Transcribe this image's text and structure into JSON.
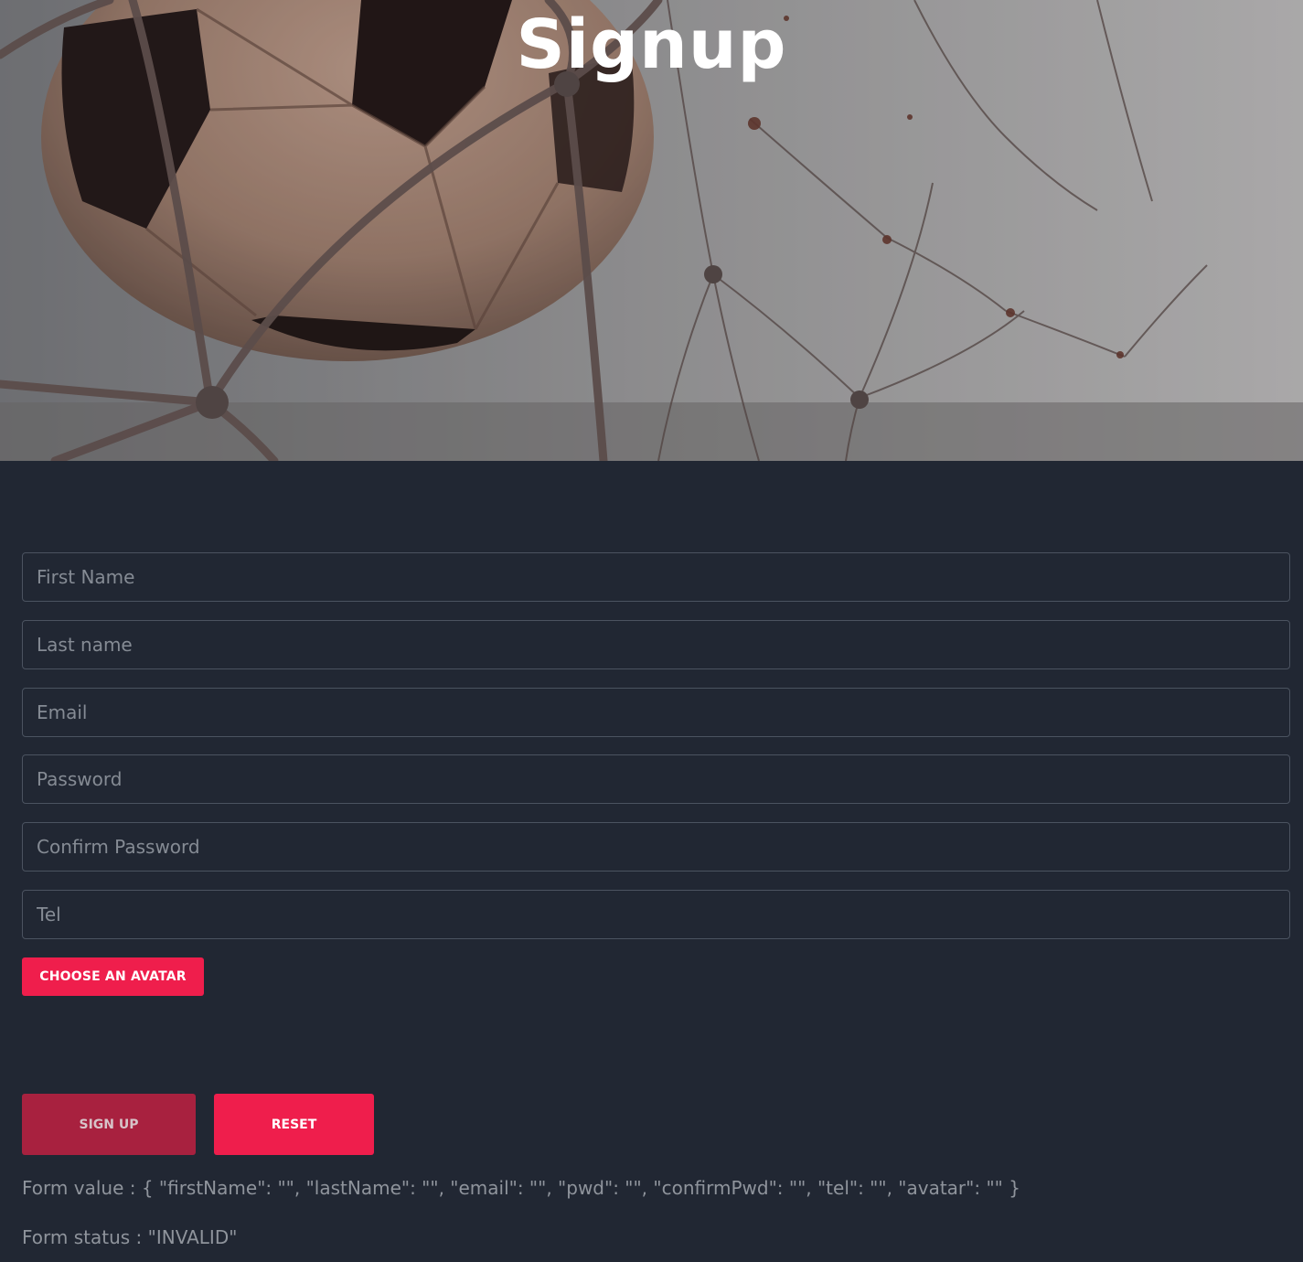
{
  "hero": {
    "title": "Signup"
  },
  "form": {
    "fields": [
      {
        "placeholder": "First Name",
        "value": ""
      },
      {
        "placeholder": "Last name",
        "value": ""
      },
      {
        "placeholder": "Email",
        "value": ""
      },
      {
        "placeholder": "Password",
        "value": ""
      },
      {
        "placeholder": "Confirm Password",
        "value": ""
      },
      {
        "placeholder": "Tel",
        "value": ""
      }
    ],
    "avatar_button_label": "CHOOSE AN AVATAR",
    "signup_button_label": "SIGN UP",
    "reset_button_label": "RESET",
    "value_text": "Form value : { \"firstName\": \"\", \"lastName\": \"\", \"email\": \"\", \"pwd\": \"\", \"confirmPwd\": \"\", \"tel\": \"\", \"avatar\": \"\" }",
    "status_text": "Form status : \"INVALID\""
  },
  "colors": {
    "background": "#212733",
    "accent": "#ef1e4c",
    "accent_disabled": "#a8213f",
    "muted_text": "#8f949c"
  }
}
